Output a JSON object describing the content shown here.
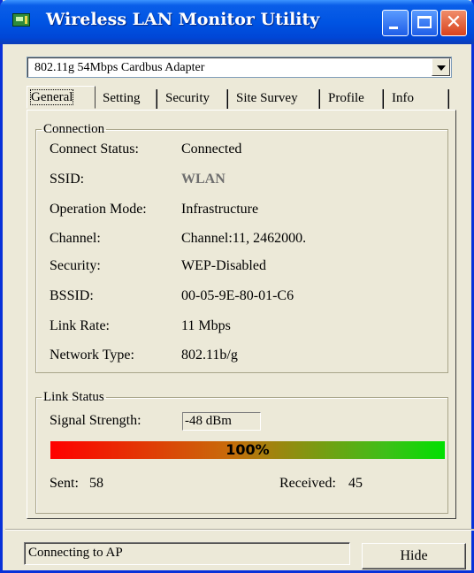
{
  "window": {
    "title": "Wireless LAN Monitor Utility",
    "title_bar_color": "#0054e3",
    "close_button_color": "#d8431e"
  },
  "adapter": {
    "selected": "802.11g 54Mbps Cardbus Adapter"
  },
  "tabs": [
    {
      "label": "General",
      "active": true
    },
    {
      "label": "Setting",
      "active": false
    },
    {
      "label": "Security",
      "active": false
    },
    {
      "label": "Site Survey",
      "active": false
    },
    {
      "label": "Profile",
      "active": false
    },
    {
      "label": "Info",
      "active": false
    }
  ],
  "connection": {
    "group_title": "Connection",
    "rows": [
      {
        "label": "Connect Status:",
        "value": "Connected"
      },
      {
        "label": "SSID:",
        "value": "WLAN"
      },
      {
        "label": "Operation Mode:",
        "value": "Infrastructure"
      },
      {
        "label": "Channel:",
        "value": "Channel:11, 2462000."
      },
      {
        "label": "Security:",
        "value": "WEP-Disabled"
      },
      {
        "label": "BSSID:",
        "value": "00-05-9E-80-01-C6"
      },
      {
        "label": "Link Rate:",
        "value": "11 Mbps"
      },
      {
        "label": "Network Type:",
        "value": "802.11b/g"
      }
    ]
  },
  "link_status": {
    "group_title": "Link Status",
    "signal_label": "Signal Strength:",
    "signal_value": "-48 dBm",
    "quality_percent": 100,
    "quality_text": "100%",
    "sent_label": "Sent:",
    "sent_value": "58",
    "received_label": "Received:",
    "received_value": "45"
  },
  "status_bar": {
    "text": "Connecting to AP"
  },
  "buttons": {
    "hide_label": "Hide"
  }
}
